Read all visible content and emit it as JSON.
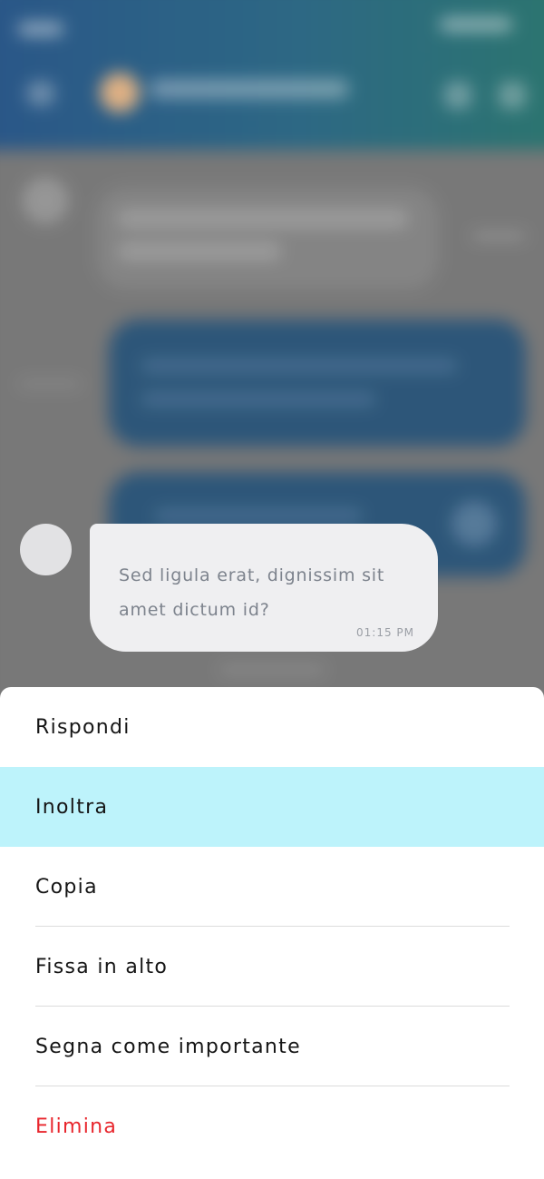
{
  "focused_message": {
    "text": "Sed ligula erat, dignissim sit amet dictum id?",
    "time": "01:15 PM"
  },
  "menu": {
    "items": [
      {
        "id": "reply",
        "label": "Rispondi"
      },
      {
        "id": "forward",
        "label": "Inoltra",
        "highlighted": true
      },
      {
        "id": "copy",
        "label": "Copia"
      },
      {
        "id": "pin",
        "label": "Fissa in alto"
      },
      {
        "id": "mark-important",
        "label": "Segna come importante"
      },
      {
        "id": "delete",
        "label": "Elimina",
        "danger": true
      }
    ]
  },
  "colors": {
    "header_gradient": [
      "#2c5a8e",
      "#2e7a74"
    ],
    "highlight": "#bdf3fb",
    "danger": "#e8262d",
    "bubble": "#efeff1"
  }
}
